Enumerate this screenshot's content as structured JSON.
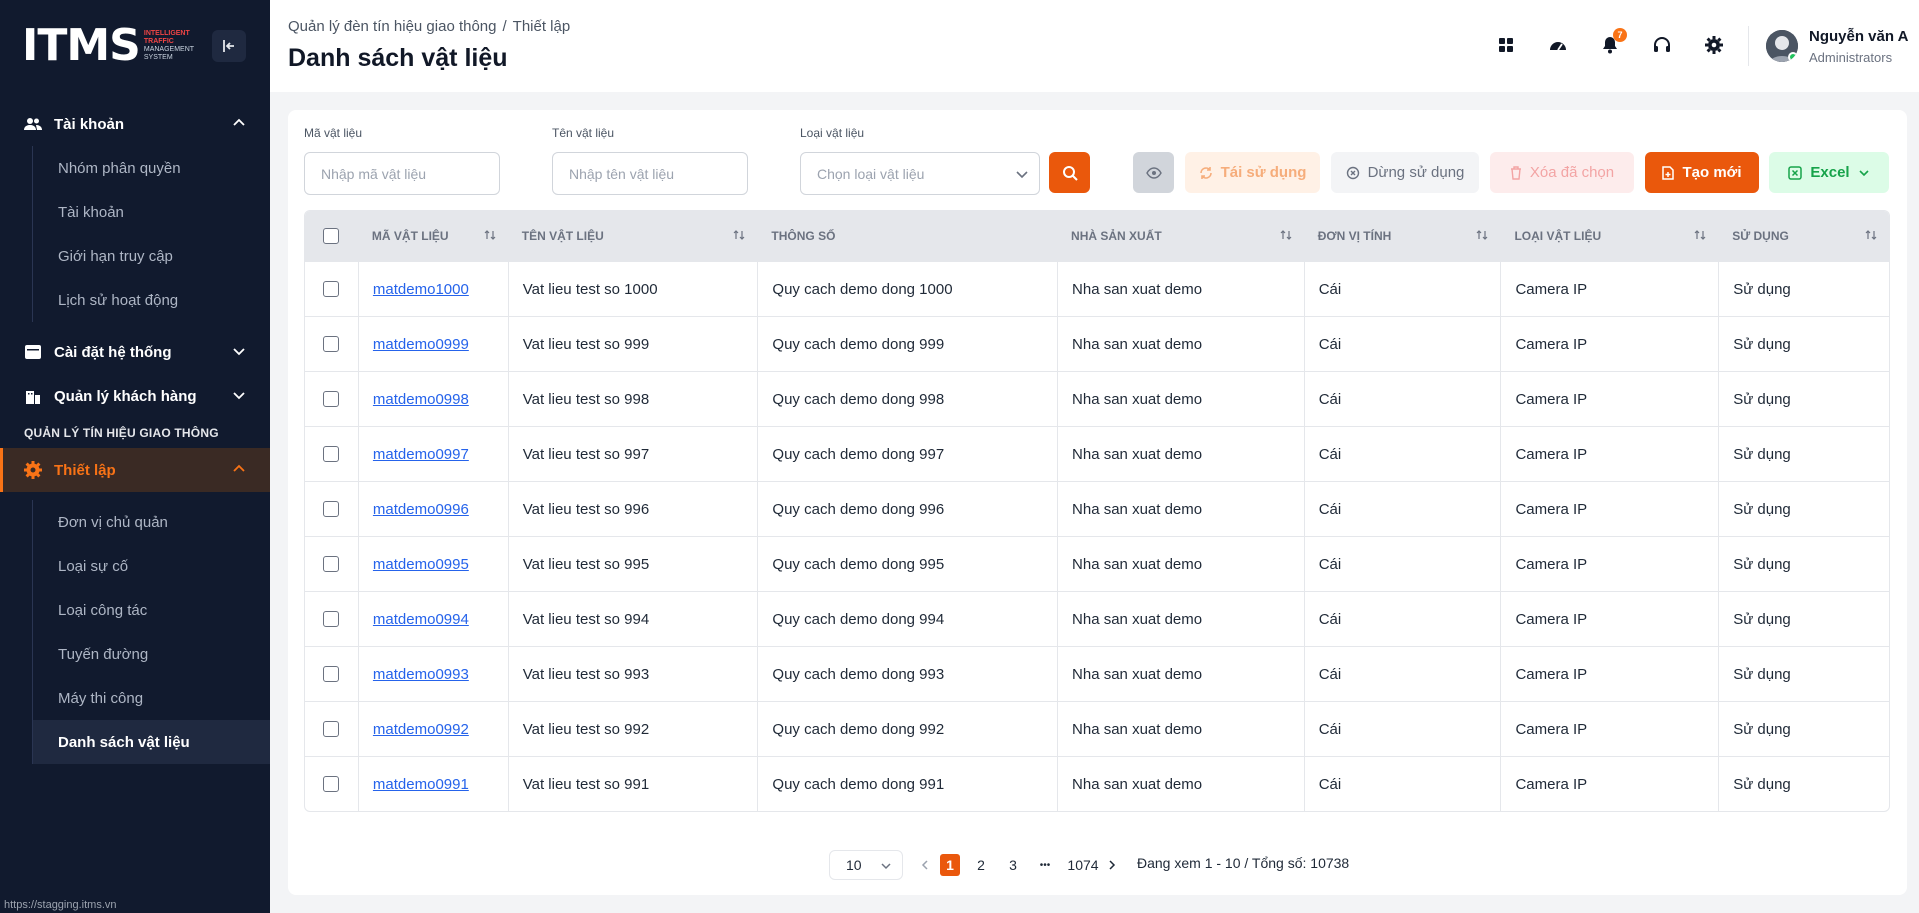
{
  "sidebar": {
    "logo": {
      "mark_left": "IT",
      "mark_right": "MS",
      "line1": "INTELLIGENT",
      "line2": "TRAFFIC",
      "line3": "MANAGEMENT",
      "line4": "SYSTEM"
    },
    "groups": {
      "account": {
        "label": "Tài khoản",
        "items": [
          "Nhóm phân quyền",
          "Tài khoản",
          "Giới hạn truy cập",
          "Lịch sử hoạt động"
        ]
      },
      "system_settings": {
        "label": "Cài đặt hệ thống"
      },
      "customers": {
        "label": "Quản lý khách hàng"
      },
      "section": "QUẢN LÝ TÍN HIỆU GIAO THÔNG",
      "setup": {
        "label": "Thiết lập",
        "items": [
          "Đơn vị chủ quản",
          "Loại sự cố",
          "Loại công tác",
          "Tuyến đường",
          "Máy thi công",
          "Danh sách vật liệu"
        ],
        "active_index": 5
      }
    },
    "status_url": "https://stagging.itms.vn"
  },
  "header": {
    "breadcrumb": [
      "Quản lý đèn tín hiệu giao thông",
      "/",
      "Thiết lập"
    ],
    "title": "Danh sách vật liệu",
    "notification_count": "7",
    "user": {
      "name": "Nguyễn văn A",
      "role": "Administrators"
    }
  },
  "filters": {
    "code": {
      "label": "Mã vật liệu",
      "placeholder": "Nhập mã vật liệu"
    },
    "name": {
      "label": "Tên vật liệu",
      "placeholder": "Nhập tên vật liệu"
    },
    "type": {
      "label": "Loại vật liệu",
      "placeholder": "Chọn loại vật liệu"
    }
  },
  "actions": {
    "reuse": "Tái sử dụng",
    "stop": "Dừng sử dụng",
    "delete": "Xóa đã chọn",
    "create": "Tạo mới",
    "excel": "Excel"
  },
  "table": {
    "columns": [
      "MÃ VẬT LIỆU",
      "TÊN VẬT LIỆU",
      "THÔNG SỐ",
      "NHÀ SẢN XUẤT",
      "ĐƠN VỊ TÍNH",
      "LOẠI VẬT LIỆU",
      "SỬ DỤNG"
    ],
    "rows": [
      [
        "matdemo1000",
        "Vat lieu test so 1000",
        "Quy cach demo dong 1000",
        "Nha san xuat demo",
        "Cái",
        "Camera IP",
        "Sử dụng"
      ],
      [
        "matdemo0999",
        "Vat lieu test so 999",
        "Quy cach demo dong 999",
        "Nha san xuat demo",
        "Cái",
        "Camera IP",
        "Sử dụng"
      ],
      [
        "matdemo0998",
        "Vat lieu test so 998",
        "Quy cach demo dong 998",
        "Nha san xuat demo",
        "Cái",
        "Camera IP",
        "Sử dụng"
      ],
      [
        "matdemo0997",
        "Vat lieu test so 997",
        "Quy cach demo dong 997",
        "Nha san xuat demo",
        "Cái",
        "Camera IP",
        "Sử dụng"
      ],
      [
        "matdemo0996",
        "Vat lieu test so 996",
        "Quy cach demo dong 996",
        "Nha san xuat demo",
        "Cái",
        "Camera IP",
        "Sử dụng"
      ],
      [
        "matdemo0995",
        "Vat lieu test so 995",
        "Quy cach demo dong 995",
        "Nha san xuat demo",
        "Cái",
        "Camera IP",
        "Sử dụng"
      ],
      [
        "matdemo0994",
        "Vat lieu test so 994",
        "Quy cach demo dong 994",
        "Nha san xuat demo",
        "Cái",
        "Camera IP",
        "Sử dụng"
      ],
      [
        "matdemo0993",
        "Vat lieu test so 993",
        "Quy cach demo dong 993",
        "Nha san xuat demo",
        "Cái",
        "Camera IP",
        "Sử dụng"
      ],
      [
        "matdemo0992",
        "Vat lieu test so 992",
        "Quy cach demo dong 992",
        "Nha san xuat demo",
        "Cái",
        "Camera IP",
        "Sử dụng"
      ],
      [
        "matdemo0991",
        "Vat lieu test so 991",
        "Quy cach demo dong 991",
        "Nha san xuat demo",
        "Cái",
        "Camera IP",
        "Sử dụng"
      ]
    ]
  },
  "pagination": {
    "page_size": "10",
    "pages": [
      "1",
      "2",
      "3",
      "1074"
    ],
    "current": "1",
    "ellipsis": "•••",
    "info": "Đang xem 1 - 10 / Tổng số: 10738"
  },
  "colors": {
    "accent": "#ea580c",
    "sidebar_bg": "#111a2e",
    "link": "#2563eb"
  }
}
